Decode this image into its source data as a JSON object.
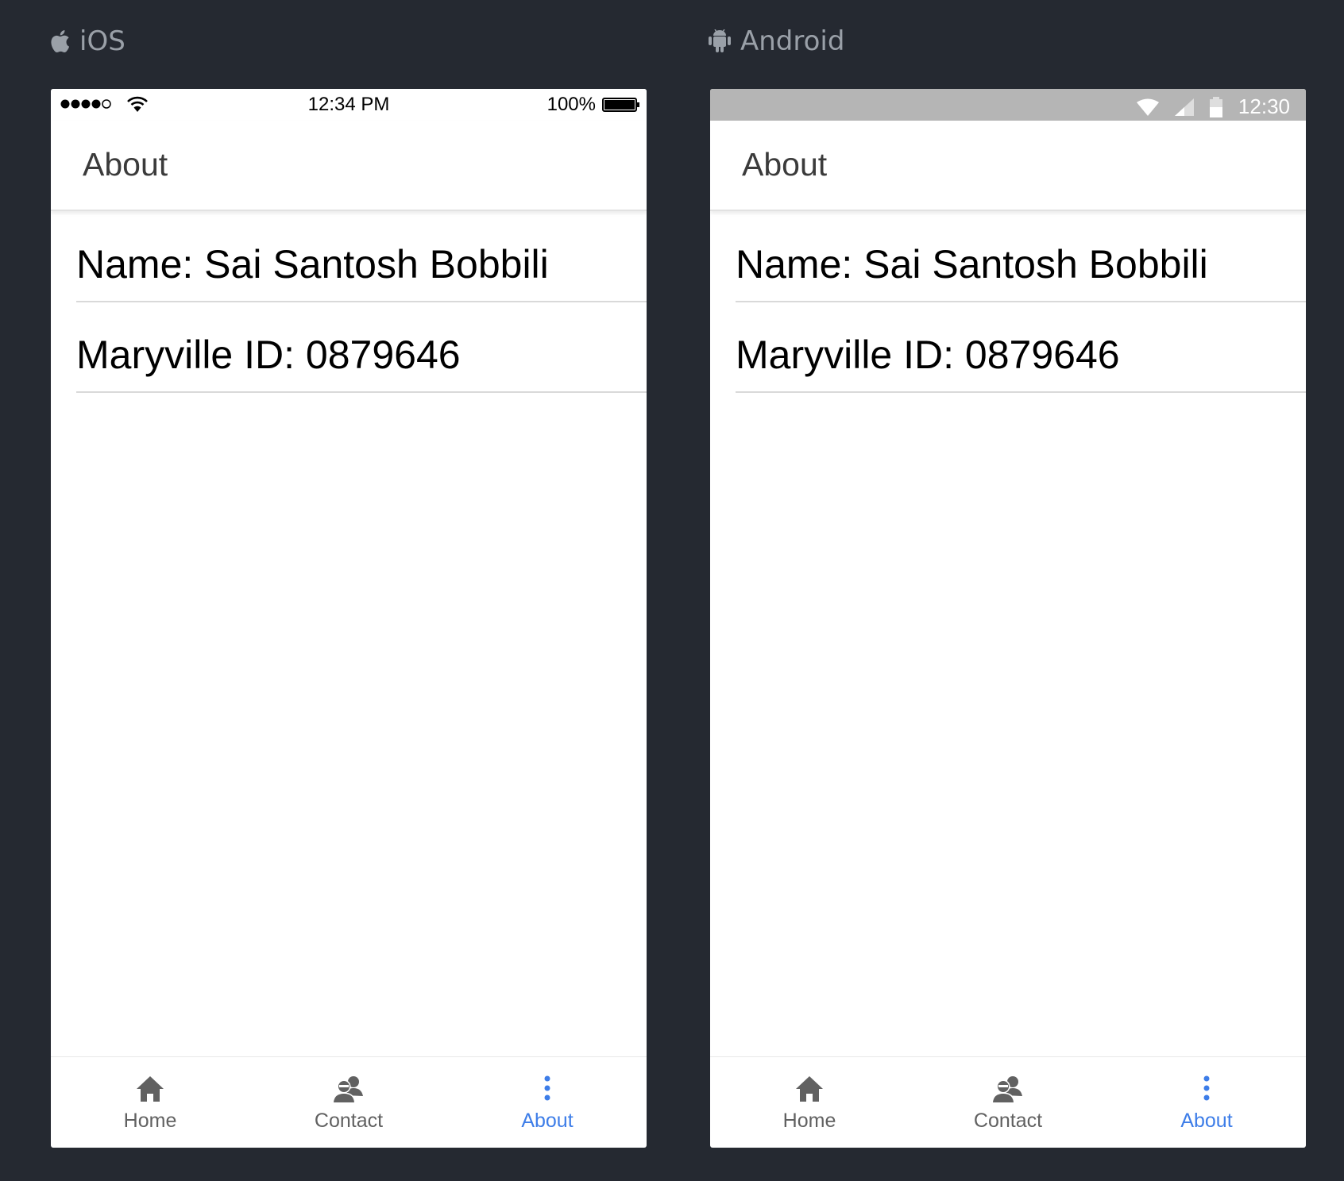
{
  "platforms": {
    "ios": {
      "label": "iOS",
      "status_bar": {
        "time": "12:34 PM",
        "battery": "100%",
        "battery_level": 1.0,
        "signal_dots": 5,
        "signal_filled": 4
      },
      "header": {
        "title": "About"
      },
      "items": [
        {
          "text": "Name: Sai Santosh Bobbili"
        },
        {
          "text": "Maryville ID: 0879646"
        }
      ],
      "tabs": [
        {
          "label": "Home",
          "icon": "home-icon",
          "active": false
        },
        {
          "label": "Contact",
          "icon": "contact-icon",
          "active": false
        },
        {
          "label": "About",
          "icon": "more-vertical-icon",
          "active": true
        }
      ]
    },
    "android": {
      "label": "Android",
      "status_bar": {
        "time": "12:30"
      },
      "header": {
        "title": "About"
      },
      "items": [
        {
          "text": "Name: Sai Santosh Bobbili"
        },
        {
          "text": "Maryville ID: 0879646"
        }
      ],
      "tabs": [
        {
          "label": "Home",
          "icon": "home-icon",
          "active": false
        },
        {
          "label": "Contact",
          "icon": "contact-icon",
          "active": false
        },
        {
          "label": "About",
          "icon": "more-vertical-icon",
          "active": true
        }
      ]
    }
  },
  "colors": {
    "background": "#252931",
    "active_tab": "#3d7de8",
    "inactive_tab": "#616161",
    "android_status_bar": "#b5b5b5"
  }
}
